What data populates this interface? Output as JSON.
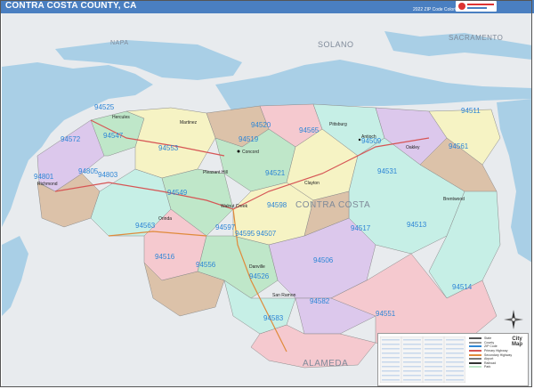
{
  "header": {
    "title": "CONTRA COSTA COUNTY, CA",
    "edition": "2022 ZIP Code ColorCast Edition"
  },
  "regions": {
    "napa": "NAPA",
    "solano": "SOLANO",
    "sacramento": "SACRAMENTO",
    "contra_costa": "CONTRA COSTA",
    "alameda": "ALAMEDA"
  },
  "zips": {
    "z94525": "94525",
    "z94572": "94572",
    "z94547": "94547",
    "z94520": "94520",
    "z94519": "94519",
    "z94565": "94565",
    "z94509": "94509",
    "z94511": "94511",
    "z94561": "94561",
    "z94553": "94553",
    "z94805": "94805",
    "z94803": "94803",
    "z94801": "94801",
    "z94521": "94521",
    "z94531": "94531",
    "z94549": "94549",
    "z94598": "94598",
    "z94513": "94513",
    "z94563": "94563",
    "z94597": "94597",
    "z94517": "94517",
    "z94595": "94595",
    "z94507": "94507",
    "z94516": "94516",
    "z94556": "94556",
    "z94506": "94506",
    "z94526": "94526",
    "z94514": "94514",
    "z94582": "94582",
    "z94583": "94583",
    "z94551": "94551"
  },
  "cities": {
    "concord": "Concord",
    "antioch": "Antioch",
    "pittsburg": "Pittsburg",
    "richmond": "Richmond",
    "walnut_creek": "Walnut Creek",
    "brentwood": "Brentwood",
    "martinez": "Martinez",
    "hercules": "Hercules",
    "pleasant_hill": "Pleasant Hill",
    "clayton": "Clayton",
    "oakley": "Oakley",
    "san_ramon": "San Ramon",
    "danville": "Danville",
    "orinda": "Orinda"
  },
  "legend": {
    "keys": [
      "State",
      "County",
      "ZIP Code",
      "Primary Highway",
      "Secondary Highway",
      "Airport",
      "Railroad",
      "Park"
    ]
  },
  "brand": {
    "logo_text": "City",
    "logo_sub": "Map"
  },
  "colors": {
    "water": "#a9cfe6",
    "land_outside": "#e8ebee",
    "zip_pink": "#f5c9cf",
    "zip_tan": "#dcc2a9",
    "zip_green": "#bfe7c9",
    "zip_yellow": "#f6f3c4",
    "zip_purple": "#dcc8ec",
    "zip_mint": "#c6efe6",
    "zip_text": "#2e86d6",
    "title_bar": "#4a7fc1"
  }
}
